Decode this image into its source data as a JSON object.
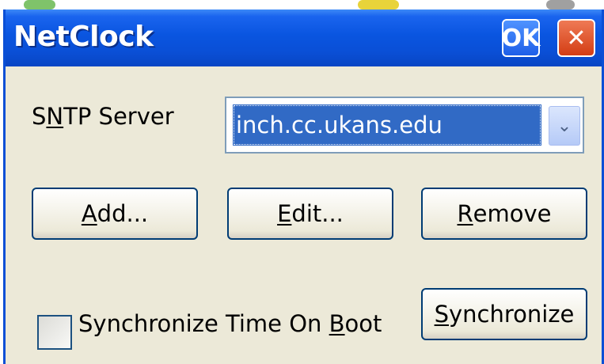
{
  "window": {
    "title": "NetClock",
    "ok_label": "OK",
    "close_glyph": "✕"
  },
  "server": {
    "label_pre": "S",
    "label_mnemonic": "N",
    "label_post": "TP Server",
    "selected_value": "inch.cc.ukans.edu",
    "dropdown_glyph": "⌄"
  },
  "buttons": {
    "add_mnemonic": "A",
    "add_rest": "dd...",
    "edit_mnemonic": "E",
    "edit_rest": "dit...",
    "remove_mnemonic": "R",
    "remove_rest": "emove",
    "sync_mnemonic": "S",
    "sync_rest": "ynchronize"
  },
  "boot_sync": {
    "checked": false,
    "label_pre": "Synchronize Time On ",
    "label_mnemonic": "B",
    "label_post": "oot"
  },
  "colors": {
    "titlebar": "#0a4fd6",
    "window_bg": "#ece9d8",
    "selection": "#316ac5",
    "close": "#d33d14"
  }
}
